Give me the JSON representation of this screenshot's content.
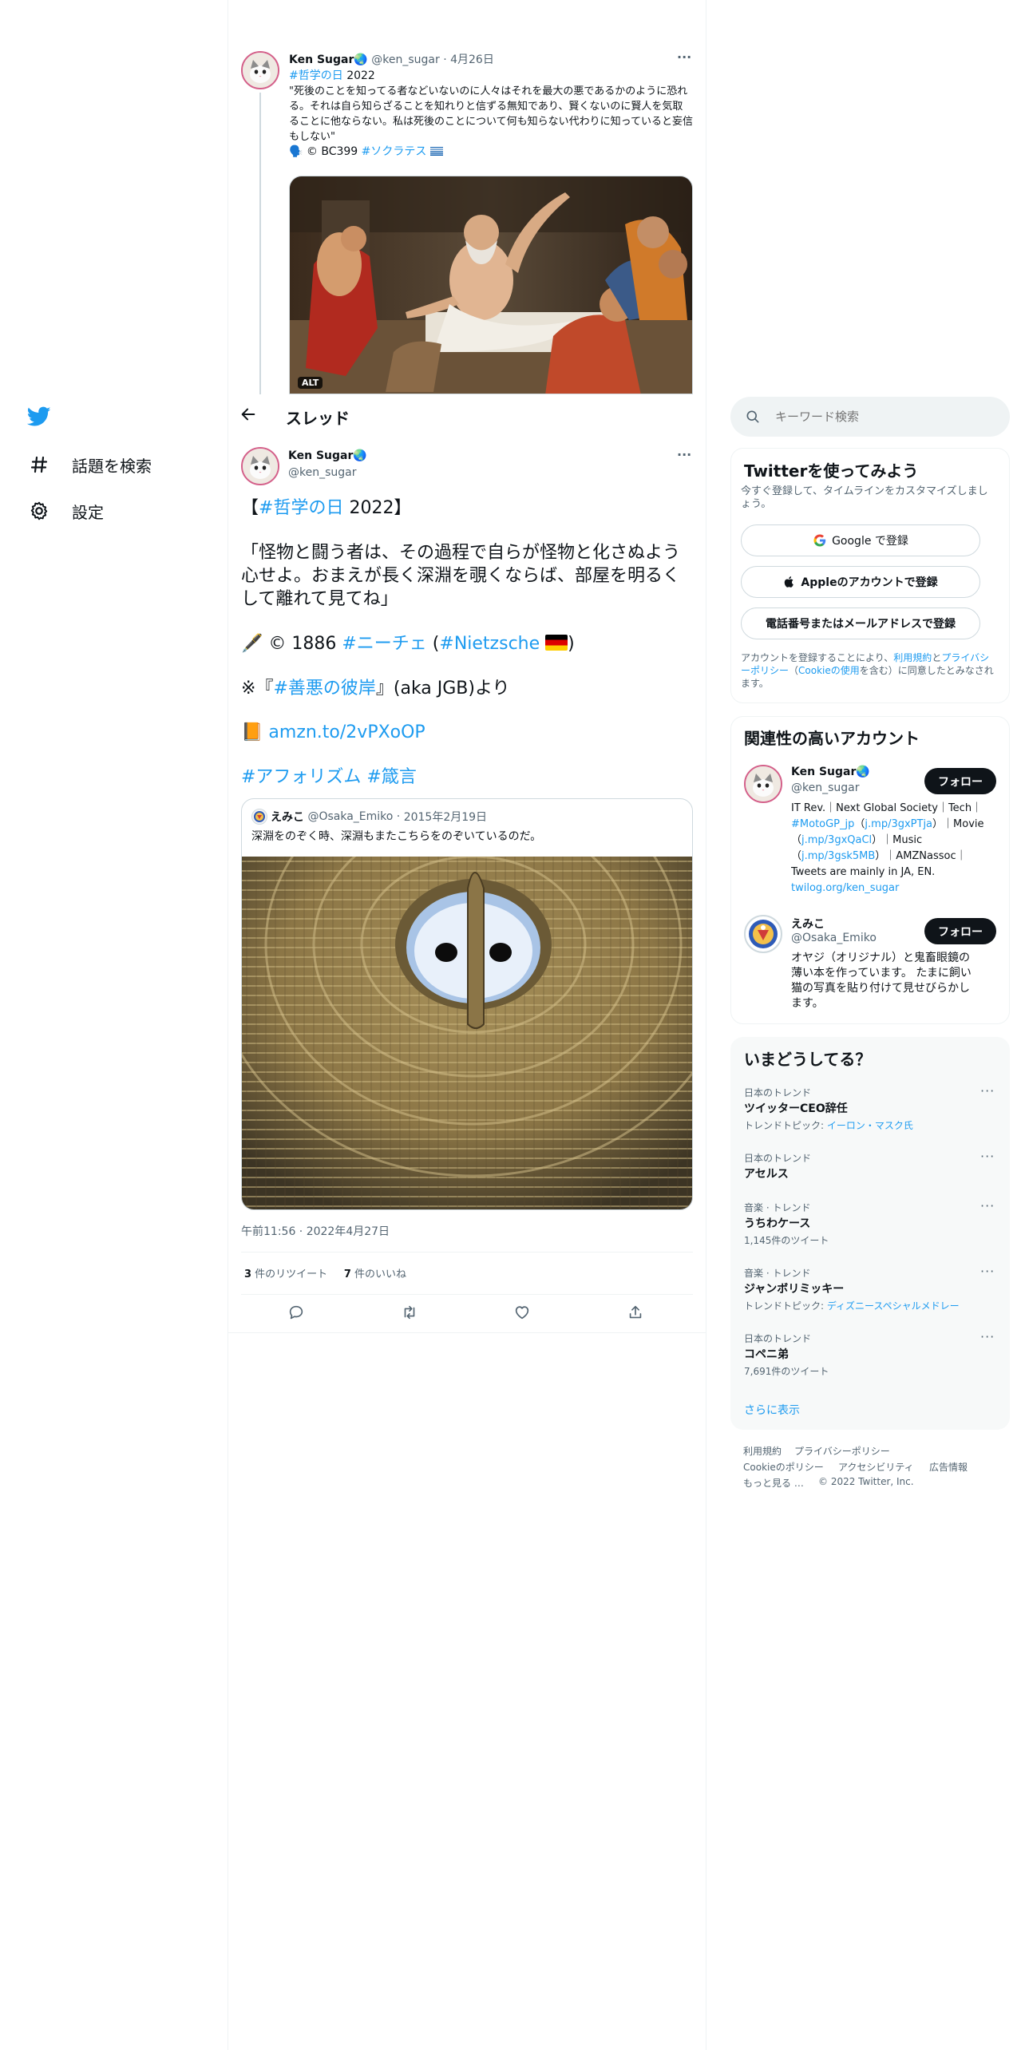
{
  "prev_tweet": {
    "name": "Ken Sugar🌏",
    "handle": "@ken_sugar",
    "date": "4月26日",
    "hashtag": "#哲学の日",
    "hashtag_rest": "2022",
    "body": "\"死後のことを知ってる者などいないのに人々はそれを最大の悪であるかのように恐れる。それは自ら知らざることを知れりと信ずる無知であり、賢くないのに賢人を気取ることに他ならない。私は死後のことについて何も知らない代わりに知っていると妄信もしない\"",
    "credit_prefix": "🗣️ © BC399",
    "credit_tag": "#ソクラテス",
    "alt_label": "ALT",
    "more": "···"
  },
  "header": {
    "back_icon": "arrow-left-icon",
    "title": "スレッド"
  },
  "nav": {
    "items": [
      {
        "icon": "twitter-bird-icon",
        "label": ""
      },
      {
        "icon": "hashtag-icon",
        "label": "話題を検索"
      },
      {
        "icon": "gear-icon",
        "label": "設定"
      }
    ]
  },
  "main_tweet": {
    "name": "Ken Sugar🌏",
    "handle": "@ken_sugar",
    "more": "···",
    "line1_open": "【",
    "line1_tag": "#哲学の日",
    "line1_close": " 2022】",
    "quote_text": "「怪物と闘う者は、その過程で自らが怪物と化さぬよう心せよ。おまえが長く深淵を覗くならば、部屋を明るくして離れて見てね」",
    "credit_prefix": "🖋️ © 1886 ",
    "credit_tag1": "#ニーチェ",
    "credit_paren_open": " (",
    "credit_tag2": "#Nietzsche",
    "credit_paren_close": ")",
    "source_prefix": "※『",
    "source_tag": "#善悪の彼岸",
    "source_suffix": "』(aka JGB)より",
    "link_emoji": "📙",
    "link": "amzn.to/2vPXoOP",
    "tags_line": "#アフォリズム #箴言",
    "timestamp": "午前11:56 · 2022年4月27日",
    "retweets_count": "3",
    "retweets_label": " 件のリツイート",
    "likes_count": "7",
    "likes_label": " 件のいいね"
  },
  "quoted_tweet": {
    "name": "えみこ",
    "handle": "@Osaka_Emiko",
    "date": "2015年2月19日",
    "text": "深淵をのぞく時、深淵もまたこちらをのぞいているのだ。"
  },
  "actions": [
    {
      "icon": "reply-icon"
    },
    {
      "icon": "retweet-icon"
    },
    {
      "icon": "like-icon"
    },
    {
      "icon": "share-icon"
    }
  ],
  "search": {
    "placeholder": "キーワード検索"
  },
  "signup": {
    "title": "Twitterを使ってみよう",
    "subtitle": "今すぐ登録して、タイムラインをカスタマイズしましょう。",
    "google_button": "Google で登録",
    "apple_button": "Appleのアカウントで登録",
    "phone_button": "電話番号またはメールアドレスで登録",
    "legal_1": "アカウントを登録することにより、",
    "legal_terms": "利用規約",
    "legal_2": "と",
    "legal_privacy": "プライバシーポリシー",
    "legal_3": "（",
    "legal_cookie": "Cookieの使用",
    "legal_4": "を含む）に同意したとみなされます。"
  },
  "related": {
    "title": "関連性の高いアカウント",
    "follow_label": "フォロー",
    "accounts": [
      {
        "name": "Ken Sugar🌏",
        "handle": "@ken_sugar",
        "bio_1": "IT Rev.｜Next Global Society｜Tech｜",
        "bio_tag": "#MotoGP_jp",
        "bio_2": "（",
        "bio_link1": "j.mp/3gxPTja",
        "bio_3": "）｜Movie（",
        "bio_link2": "j.mp/3gxQaCl",
        "bio_4": "）｜Music（",
        "bio_link3": "j.mp/3gsk5MB",
        "bio_5": "）｜AMZNassoc｜Tweets are mainly in JA, EN.",
        "bio_link4": "twilog.org/ken_sugar"
      },
      {
        "name": "えみこ",
        "handle": "@Osaka_Emiko",
        "bio": "オヤジ（オリジナル）と鬼畜眼鏡の薄い本を作っています。 たまに飼い猫の写真を貼り付けて見せびらかします。"
      }
    ]
  },
  "trends": {
    "title": "いまどうしてる？",
    "more_icon": "···",
    "items": [
      {
        "category": "日本のトレンド",
        "name": "ツイッターCEO辞任",
        "meta_prefix": "トレンドトピック: ",
        "meta_link": "イーロン・マスク氏"
      },
      {
        "category": "日本のトレンド",
        "name": "アセルス"
      },
      {
        "category": "音楽 · トレンド",
        "name": "うちわケース",
        "meta": "1,145件のツイート"
      },
      {
        "category": "音楽 · トレンド",
        "name": "ジャンボリミッキー",
        "meta_prefix": "トレンドトピック: ",
        "meta_link": "ディズニースペシャルメドレー"
      },
      {
        "category": "日本のトレンド",
        "name": "コペニ弟",
        "meta": "7,691件のツイート"
      }
    ],
    "show_more": "さらに表示"
  },
  "footer": {
    "links": [
      "利用規約",
      "プライバシーポリシー",
      "Cookieのポリシー",
      "アクセシビリティ",
      "広告情報",
      "もっと見る …"
    ],
    "copyright": "© 2022 Twitter, Inc."
  },
  "colors": {
    "accent": "#1d9bf0",
    "text": "#0f1419",
    "secondary": "#536471",
    "border": "#eff3f4"
  }
}
